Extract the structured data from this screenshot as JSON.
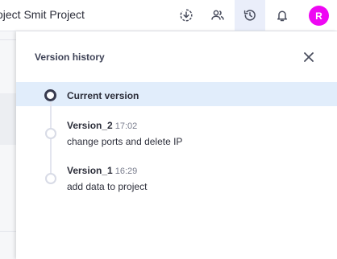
{
  "header": {
    "project_title": "oject Smit Project",
    "icons": [
      "download-icon",
      "users-icon",
      "history-icon",
      "bell-icon"
    ],
    "avatar_initial": "R",
    "avatar_color": "#ee07f3",
    "active_color": "#eaeefa"
  },
  "panel": {
    "title": "Version history",
    "current_label": "Current version",
    "versions": [
      {
        "name": "Version_2",
        "time": "17:02",
        "description": "change ports and delete IP"
      },
      {
        "name": "Version_1",
        "time": "16:29",
        "description": "add data to project"
      }
    ]
  },
  "colors": {
    "highlight": "#e1edfb",
    "text": "#2c2e3a",
    "muted": "#7a7e8e"
  }
}
